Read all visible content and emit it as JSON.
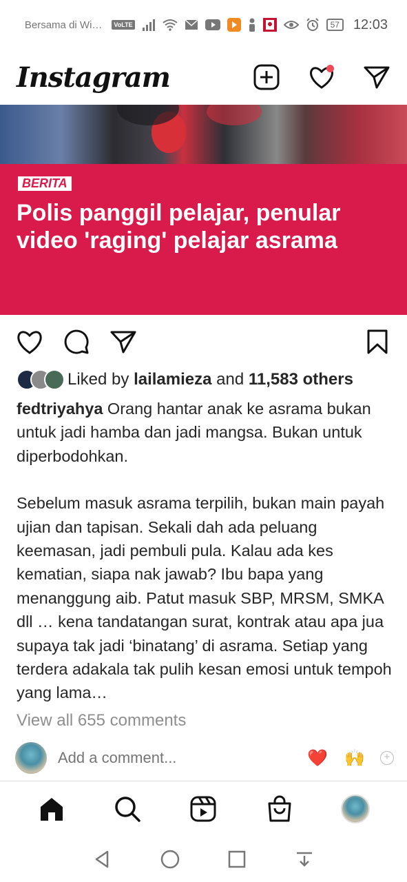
{
  "status_bar": {
    "carrier": "Bersama di Wi…",
    "volte": "VoLTE",
    "battery": "57",
    "time": "12:03"
  },
  "header": {
    "logo": "Instagram",
    "icons": [
      "new-post-icon",
      "heart-icon",
      "direct-message-icon"
    ]
  },
  "post": {
    "news_tag": "BERITA",
    "headline": "Polis panggil pelajar, penular video 'raging' pelajar asrama",
    "likes": {
      "prefix": "Liked by ",
      "user": "lailamieza",
      "middle": " and ",
      "others": "11,583 others"
    },
    "caption": {
      "username": "fedtriyahya",
      "para1": "Orang hantar anak ke asrama bukan untuk jadi hamba dan jadi mangsa. Bukan untuk diperbodohkan.",
      "para2": "Sebelum masuk asrama terpilih, bukan main payah ujian dan tapisan. Sekali dah ada peluang keemasan, jadi pembuli pula. Kalau ada kes kematian, siapa nak jawab? Ibu bapa yang menanggung aib. Patut masuk SBP, MRSM, SMKA dll … kena tandatangan surat, kontrak atau apa jua supaya tak jadi ‘binatang’ di asrama. Setiap yang terdera adakala tak pulih kesan emosi untuk tempoh yang lama…"
    },
    "view_comments": "View all 655 comments",
    "add_comment_placeholder": "Add a comment...",
    "quick_emojis": [
      "❤️",
      "🙌"
    ]
  },
  "colors": {
    "news_red": "#d81b4a",
    "notification_dot": "#ed4956",
    "muted_text": "#8e8e8e"
  }
}
